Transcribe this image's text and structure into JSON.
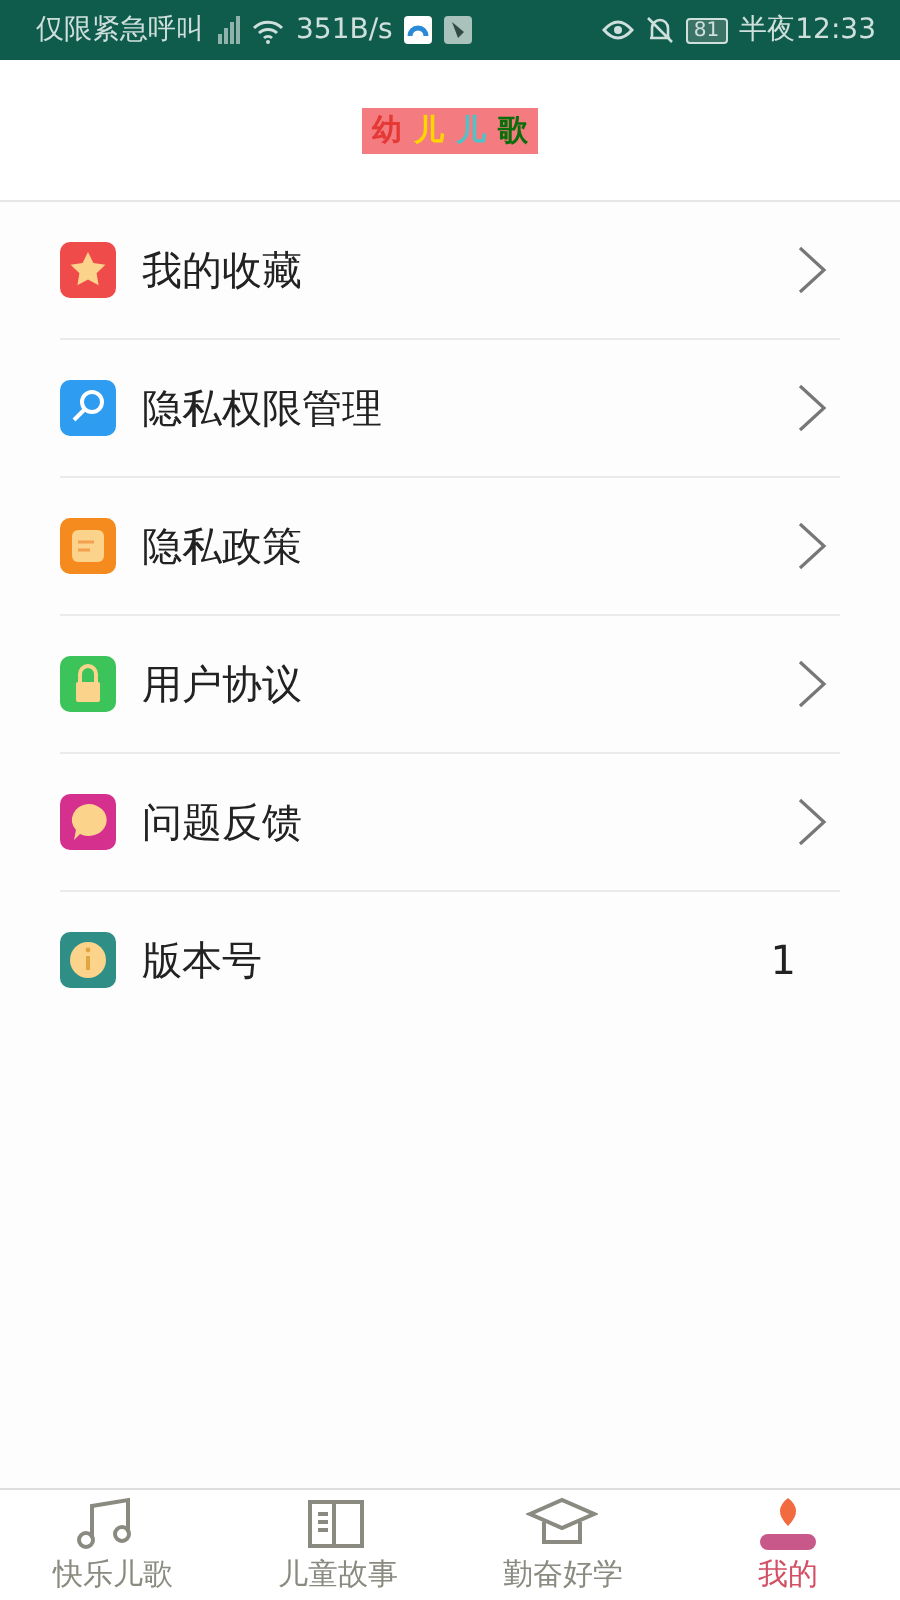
{
  "status_bar": {
    "carrier": "仅限紧急呼叫",
    "speed": "351B/s",
    "battery": "81",
    "time": "半夜12:33"
  },
  "logo": [
    {
      "text": "幼",
      "color": "#e53935"
    },
    {
      "text": "儿",
      "color": "#ffd600"
    },
    {
      "text": "儿",
      "color": "#4fc3c8"
    },
    {
      "text": "歌",
      "color": "#0a6e0a"
    }
  ],
  "menu": [
    {
      "label": "我的收藏",
      "kind": "link",
      "color": "#ef4b4b"
    },
    {
      "label": "隐私权限管理",
      "kind": "link",
      "color": "#2e9cf0"
    },
    {
      "label": "隐私政策",
      "kind": "link",
      "color": "#f58a1f"
    },
    {
      "label": "用户协议",
      "kind": "link",
      "color": "#3cc45a"
    },
    {
      "label": "问题反馈",
      "kind": "link",
      "color": "#d6308f"
    },
    {
      "label": "版本号",
      "kind": "value",
      "value": "1",
      "color": "#2f8f86"
    }
  ],
  "tabs": [
    {
      "label": "快乐儿歌",
      "selected": false
    },
    {
      "label": "儿童故事",
      "selected": false
    },
    {
      "label": "勤奋好学",
      "selected": false
    },
    {
      "label": "我的",
      "selected": true
    }
  ]
}
